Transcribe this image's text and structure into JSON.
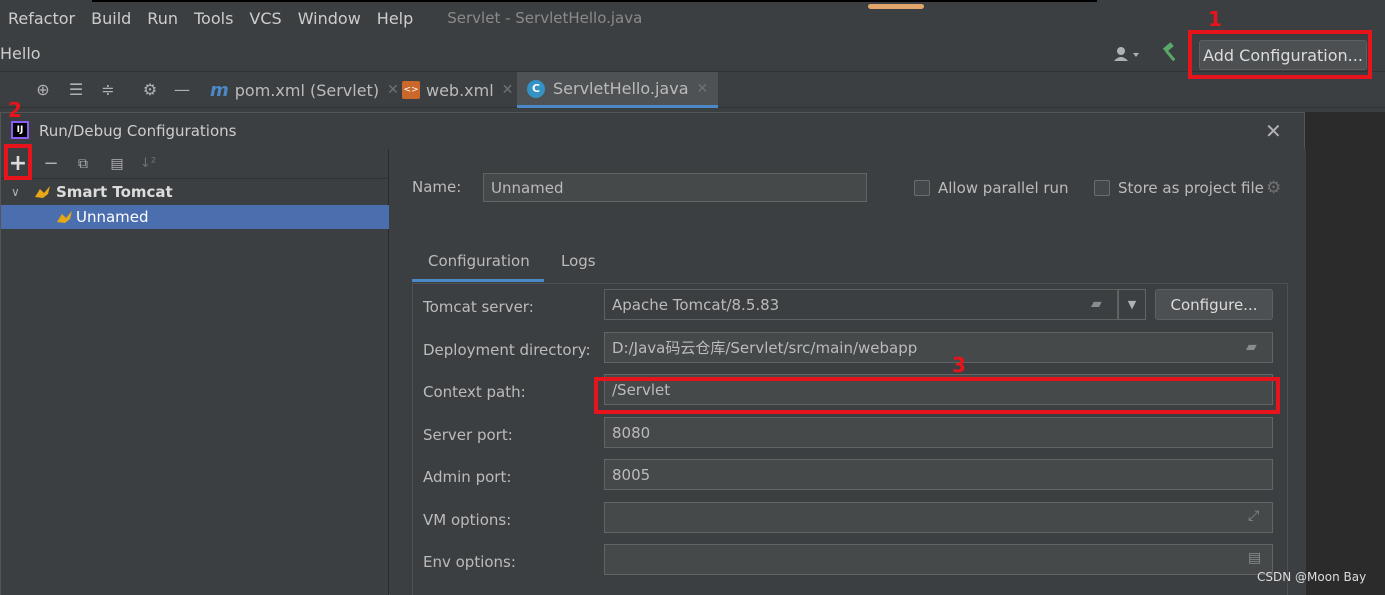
{
  "menu": {
    "items": [
      "Refactor",
      "Build",
      "Run",
      "Tools",
      "VCS",
      "Window",
      "Help"
    ],
    "window_title": "Servlet - ServletHello.java"
  },
  "toolbar": {
    "project_crumb": "Hello",
    "add_configuration": "Add Configuration..."
  },
  "tabs": [
    {
      "label": "pom.xml (Servlet)",
      "icon": "maven-file-icon"
    },
    {
      "label": "web.xml",
      "icon": "xml-file-icon"
    },
    {
      "label": "ServletHello.java",
      "icon": "java-class-icon"
    }
  ],
  "dialog": {
    "title": "Run/Debug Configurations",
    "tree": {
      "group": "Smart Tomcat",
      "item": "Unnamed"
    },
    "name_label": "Name:",
    "name_value": "Unnamed",
    "allow_parallel": "Allow parallel run",
    "store_project": "Store as project file",
    "tabs": [
      "Configuration",
      "Logs"
    ],
    "fields": {
      "tomcat_server_label": "Tomcat server:",
      "tomcat_server_value": "Apache Tomcat/8.5.83",
      "configure_button": "Configure...",
      "deployment_dir_label": "Deployment directory:",
      "deployment_dir_value": "D:/Java码云仓库/Servlet/src/main/webapp",
      "context_path_label": "Context path:",
      "context_path_value": "/Servlet",
      "server_port_label": "Server port:",
      "server_port_value": "8080",
      "admin_port_label": "Admin port:",
      "admin_port_value": "8005",
      "vm_options_label": "VM options:",
      "vm_options_value": "",
      "env_options_label": "Env options:",
      "env_options_value": ""
    }
  },
  "annotations": [
    "1",
    "2",
    "3"
  ],
  "watermark": "CSDN @Moon Bay",
  "colors": {
    "annotation_red": "#e8141c",
    "selection_blue": "#4b6eaf",
    "accent_blue": "#4a88c7"
  }
}
